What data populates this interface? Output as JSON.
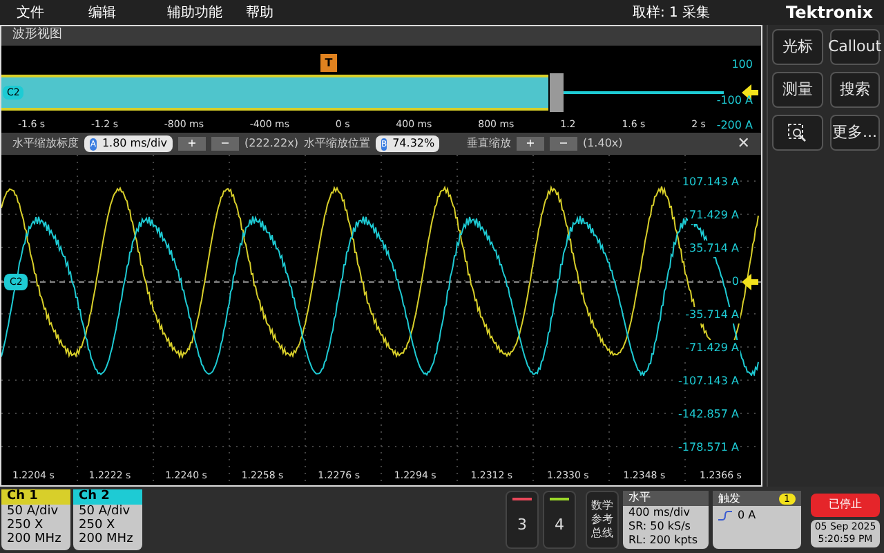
{
  "menu": [
    "文件",
    "编辑",
    "辅助功能",
    "帮助"
  ],
  "acquisition": "取样: 1 采集",
  "brand": "Tektronix",
  "waveform_view": {
    "title": "波形视图",
    "overview": {
      "channel_tag": "C2",
      "trigger_marker": "T",
      "x_labels": [
        "-1.6 s",
        "-1.2 s",
        "-800 ms",
        "-400 ms",
        "0 s",
        "400 ms",
        "800 ms",
        "1.2",
        "1.6 s",
        "2 s"
      ],
      "y_labels": [
        "100",
        "-100 A",
        "-200 A"
      ]
    },
    "zoom_bar": {
      "h_scale_label": "水平缩放标度",
      "h_scale_badge": "A",
      "h_scale_value": "1.80 ms/div",
      "plus": "+",
      "minus": "−",
      "h_factor": "(222.22x)",
      "h_pos_label": "水平缩放位置",
      "h_pos_badge": "B",
      "h_pos_value": "74.32%",
      "v_label": "垂直缩放",
      "v_factor": "(1.40x)",
      "close": "✕"
    },
    "plot": {
      "channel_tag": "C2",
      "y_labels": [
        "107.143 A",
        "71.429 A",
        "35.714 A",
        "0",
        "-35.714 A",
        "-71.429 A",
        "-107.143 A",
        "-142.857 A",
        "-178.571 A"
      ],
      "x_labels": [
        "1.2204 s",
        "1.2222 s",
        "1.2240 s",
        "1.2258 s",
        "1.2276 s",
        "1.2294 s",
        "1.2312 s",
        "1.2330 s",
        "1.2348 s",
        "1.2366 s"
      ]
    }
  },
  "side_buttons": [
    {
      "label": "光标",
      "kind": "text"
    },
    {
      "label": "Callout",
      "kind": "text"
    },
    {
      "label": "测量",
      "kind": "text"
    },
    {
      "label": "搜索",
      "kind": "text"
    },
    {
      "kind": "icon"
    },
    {
      "label": "更多...",
      "kind": "text"
    }
  ],
  "channels": [
    {
      "name": "Ch 1",
      "color": "#d8cf2a",
      "lines": [
        "50 A/div",
        "250 X",
        "200 MHz"
      ]
    },
    {
      "name": "Ch 2",
      "color": "#1ecbd4",
      "lines": [
        "50 A/div",
        "250 X",
        "200 MHz"
      ]
    }
  ],
  "add_channels": [
    {
      "label": "3",
      "color": "#e8485a"
    },
    {
      "label": "4",
      "color": "#9bd82a"
    }
  ],
  "math_ref_bus": [
    "数学",
    "参考",
    "总线"
  ],
  "horizontal": {
    "title": "水平",
    "lines": [
      "400 ms/div",
      "SR: 50 kS/s",
      "RL: 200 kpts"
    ]
  },
  "trigger": {
    "title": "触发",
    "source": "1",
    "level": "0 A"
  },
  "run_state": {
    "label": "已停止",
    "date": "05 Sep 2025",
    "time": "5:20:59 PM"
  }
}
